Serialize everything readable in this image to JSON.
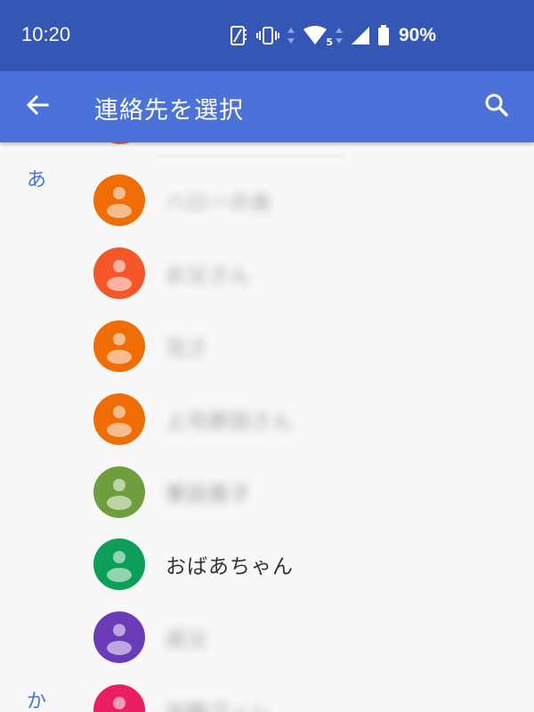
{
  "status_bar": {
    "time": "10:20",
    "network_label": "5",
    "battery_percent": "90%",
    "icons": [
      "auto-rotate-icon",
      "vibrate-icon",
      "data-arrows-icon",
      "wifi-icon",
      "signal-icon",
      "battery-icon"
    ]
  },
  "app_bar": {
    "title": "連絡先を選択",
    "back_icon": "arrow-back-icon",
    "search_icon": "search-icon"
  },
  "sections": [
    "あ",
    "か"
  ],
  "contacts": [
    {
      "name": "ハローの会",
      "color": "#f06d05",
      "blurred": true
    },
    {
      "name": "お父さん",
      "color": "#f5572b",
      "blurred": true
    },
    {
      "name": "兄さ",
      "color": "#f06d05",
      "blurred": true
    },
    {
      "name": "上司原田さん",
      "color": "#f06d05",
      "blurred": true
    },
    {
      "name": "栗田貴子",
      "color": "#6f9f3c",
      "blurred": true
    },
    {
      "name": "おばあちゃん",
      "color": "#0d9f5a",
      "blurred": false
    },
    {
      "name": "叔父",
      "color": "#6a3cb8",
      "blurred": true
    },
    {
      "name": "加藤ヴィレ",
      "color": "#e91e63",
      "blurred": true
    }
  ],
  "colors": {
    "status_bar": "#3457b5",
    "app_bar": "#4a72d8",
    "accent": "#4a72d8",
    "background": "#f8f8f8"
  }
}
